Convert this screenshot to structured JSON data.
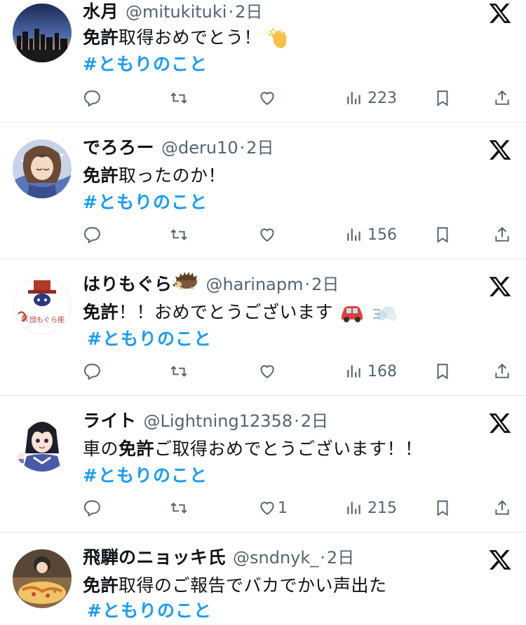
{
  "tweets": [
    {
      "name": "水月",
      "handle": "@mitukituki",
      "time": "2日",
      "text_bold": "免許",
      "text_rest": "取得おめでとう！",
      "emoji": "clapping-hands",
      "hashtag": "#ともりのこと",
      "likes": "",
      "views": "223"
    },
    {
      "name": "でろろー",
      "handle": "@deru10",
      "time": "2日",
      "text_bold": "免許",
      "text_rest": "取ったのか！",
      "emoji": "",
      "hashtag": "#ともりのこと",
      "likes": "",
      "views": "156"
    },
    {
      "name": "はりもぐら",
      "name_emoji": "hedgehog",
      "handle": "@harinapm",
      "time": "2日",
      "text_bold": "免許",
      "text_rest": "！！おめでとうございます",
      "emoji": "car-dash",
      "hashtag": "#ともりのこと",
      "likes": "",
      "views": "168"
    },
    {
      "name": "ライト",
      "handle": "@Lightning12358",
      "time": "2日",
      "text_pre": "車の",
      "text_bold": "免許",
      "text_rest": "ご取得おめでとうございます！！",
      "emoji": "",
      "hashtag": "#ともりのこと",
      "likes": "1",
      "views": "215"
    },
    {
      "name": "飛騨のニョッキ氏",
      "handle": "@sndnyk_",
      "time": "2日",
      "text_bold": "免許",
      "text_rest": "取得のご報告でバカでかい声出た",
      "emoji": "",
      "hashtag": "#ともりのこと",
      "likes": "",
      "views": ""
    }
  ],
  "colors": {
    "text": "#0f1419",
    "secondary": "#536471",
    "link": "#1d9bf0",
    "divider": "#e6e9ec"
  }
}
